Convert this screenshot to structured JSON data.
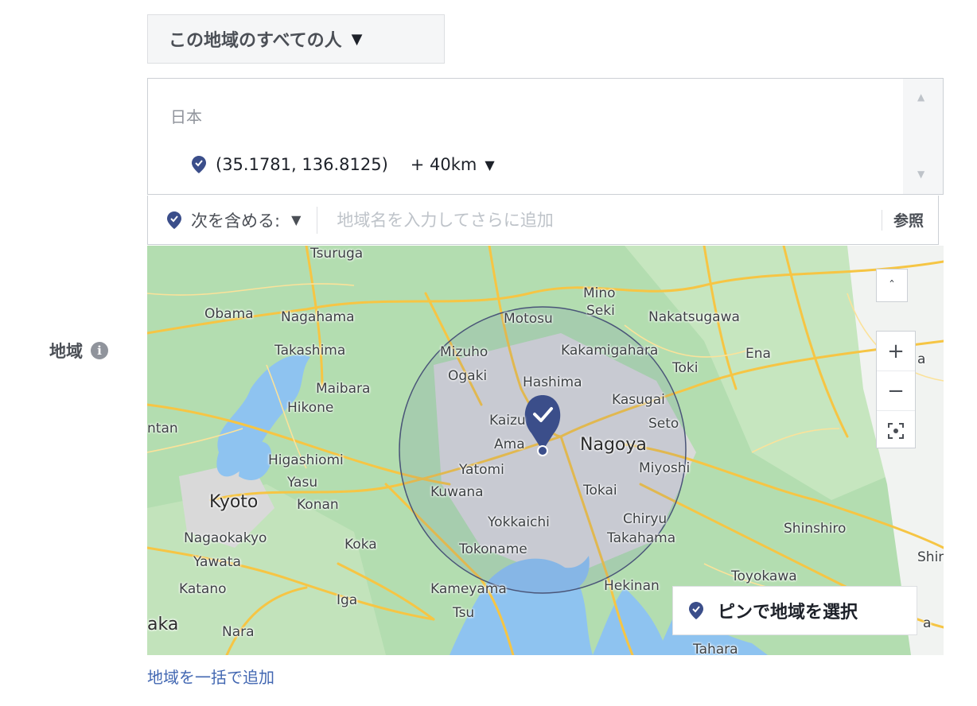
{
  "audience_dropdown": {
    "label": "この地域のすべての人"
  },
  "location_list": {
    "country": "日本",
    "items": [
      {
        "coords": "(35.1781, 136.8125)",
        "radius": "+ 40km"
      }
    ]
  },
  "include_bar": {
    "mode_label": "次を含める:",
    "placeholder": "地域名を入力してさらに追加",
    "browse_label": "参照"
  },
  "field_label": "地域",
  "info_icon_glyph": "i",
  "map": {
    "place_labels": [
      "Tsuruga",
      "Obama",
      "Nagahama",
      "Mino",
      "Seki",
      "Motosu",
      "Nakatsugawa",
      "Takashima",
      "Mizuho",
      "Kakamigahara",
      "Toki",
      "Ena",
      "Maibara",
      "Ogaki",
      "Hashima",
      "Kasugai",
      "Hikone",
      "Kaizu",
      "Seto",
      "ntan",
      "Ama",
      "Nagoya",
      "Higashiomi",
      "Yatomi",
      "Miyoshi",
      "Yasu",
      "Kyoto",
      "Konan",
      "Kuwana",
      "Tokai",
      "Yokkaichi",
      "Chiryu",
      "Shinshiro",
      "Nagaokakyo",
      "Koka",
      "Tokoname",
      "Takahama",
      "Yawata",
      "Shim",
      "Katano",
      "Iga",
      "Kameyama",
      "Hekinan",
      "Toyokawa",
      "Tsu",
      "aka",
      "Nara",
      "Tahara",
      "a",
      "a"
    ],
    "zoom_in": "+",
    "zoom_out": "−",
    "collapse": "ˆ",
    "pin_select_label": "ピンで地域を選択"
  },
  "bulk_add_link": "地域を一括で追加",
  "colors": {
    "accent": "#4267b2",
    "pin": "#3b4e8a",
    "map_land": "#b3ddb0",
    "map_water": "#8ec3f0",
    "road": "#f6c544"
  },
  "icons": {
    "caret": "caret-down-icon",
    "pin": "map-pin-icon",
    "info": "info-icon",
    "fullscreen": "recenter-icon"
  }
}
